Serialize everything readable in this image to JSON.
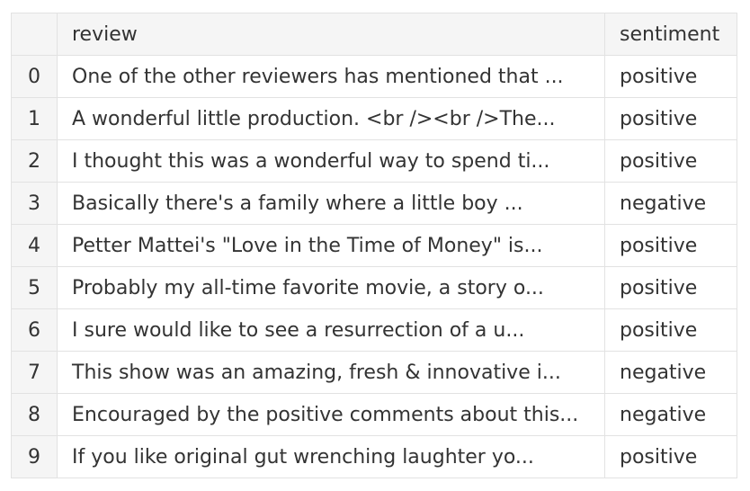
{
  "table": {
    "columns": {
      "index": "",
      "review": "review",
      "sentiment": "sentiment"
    },
    "rows": [
      {
        "index": "0",
        "review": "One of the other reviewers has mentioned that ...",
        "sentiment": "positive"
      },
      {
        "index": "1",
        "review": "A wonderful little production. <br /><br />The...",
        "sentiment": "positive"
      },
      {
        "index": "2",
        "review": "I thought this was a wonderful way to spend ti...",
        "sentiment": "positive"
      },
      {
        "index": "3",
        "review": "Basically there's a family where a little boy ...",
        "sentiment": "negative"
      },
      {
        "index": "4",
        "review": "Petter Mattei's \"Love in the Time of Money\" is...",
        "sentiment": "positive"
      },
      {
        "index": "5",
        "review": "Probably my all-time favorite movie, a story o...",
        "sentiment": "positive"
      },
      {
        "index": "6",
        "review": "I sure would like to see a resurrection of a u...",
        "sentiment": "positive"
      },
      {
        "index": "7",
        "review": "This show was an amazing, fresh & innovative i...",
        "sentiment": "negative"
      },
      {
        "index": "8",
        "review": "Encouraged by the positive comments about this...",
        "sentiment": "negative"
      },
      {
        "index": "9",
        "review": "If you like original gut wrenching laughter yo...",
        "sentiment": "positive"
      }
    ]
  }
}
